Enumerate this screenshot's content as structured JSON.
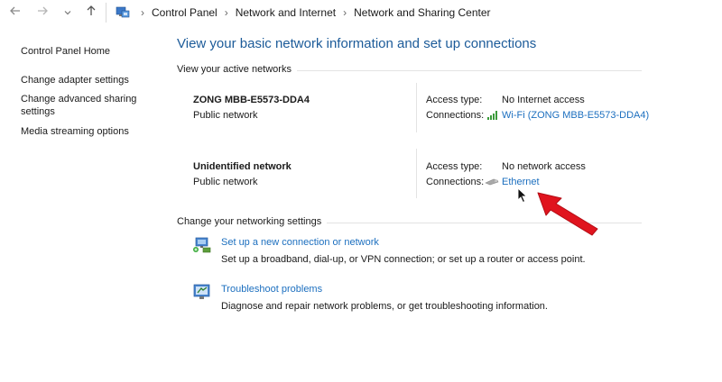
{
  "breadcrumb": {
    "items": [
      "Control Panel",
      "Network and Internet",
      "Network and Sharing Center"
    ]
  },
  "sidebar": {
    "items": [
      {
        "label": "Control Panel Home"
      },
      {
        "label": "Change adapter settings"
      },
      {
        "label": "Change advanced sharing settings"
      },
      {
        "label": "Media streaming options"
      }
    ]
  },
  "main": {
    "title": "View your basic network information and set up connections",
    "active_label": "View your active networks",
    "networks": [
      {
        "name": "ZONG MBB-E5573-DDA4",
        "type": "Public network",
        "access_key": "Access type:",
        "access_val": "No Internet access",
        "conn_key": "Connections:",
        "conn_val": "Wi-Fi (ZONG MBB-E5573-DDA4)"
      },
      {
        "name": "Unidentified network",
        "type": "Public network",
        "access_key": "Access type:",
        "access_val": "No network access",
        "conn_key": "Connections:",
        "conn_val": "Ethernet"
      }
    ],
    "settings_label": "Change your networking settings",
    "tasks": [
      {
        "link": "Set up a new connection or network",
        "desc": "Set up a broadband, dial-up, or VPN connection; or set up a router or access point."
      },
      {
        "link": "Troubleshoot problems",
        "desc": "Diagnose and repair network problems, or get troubleshooting information."
      }
    ]
  },
  "colors": {
    "title_blue": "#1c5b99",
    "link_blue": "#1c6fbf",
    "arrow_red": "#e0141e",
    "wifi_green": "#3a9a3a"
  },
  "icons": {
    "back": "arrow-left-icon",
    "forward": "arrow-right-icon",
    "recent": "chevron-down-icon",
    "up": "arrow-up-icon",
    "wifi": "wifi-signal-icon",
    "ethernet": "ethernet-cable-icon"
  }
}
